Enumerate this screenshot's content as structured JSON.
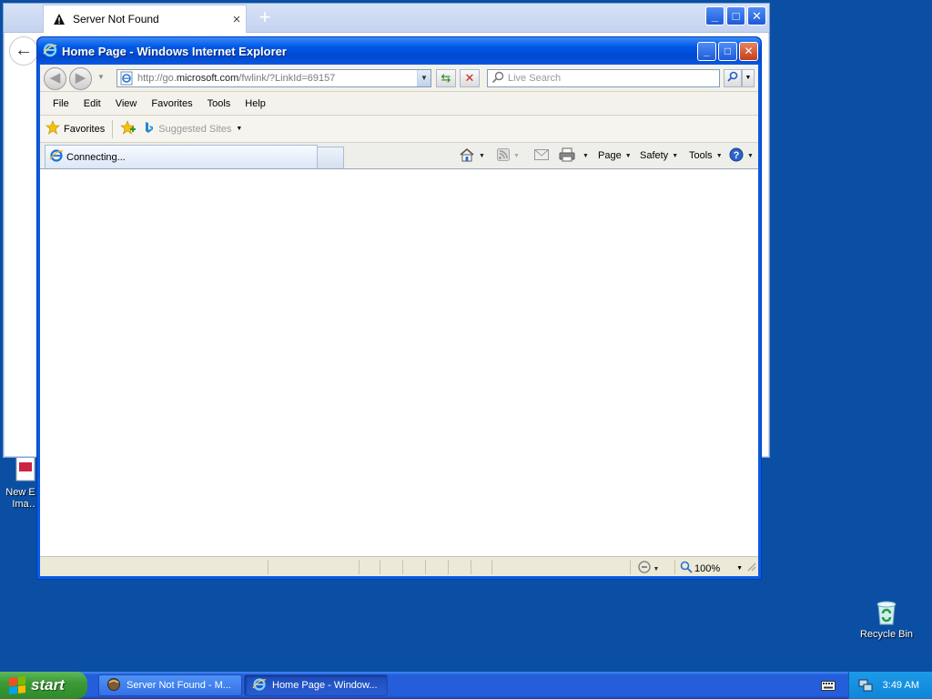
{
  "desktop": {
    "icons": [
      {
        "label": "New E… Ima…"
      },
      {
        "label": "Recycle Bin"
      }
    ]
  },
  "background_window": {
    "tab_title": "Server Not Found",
    "close_tab": "×",
    "new_tab": "+",
    "back_glyph": "←"
  },
  "ie": {
    "title": "Home Page - Windows Internet Explorer",
    "address": {
      "prefix": "http://go.",
      "domain": "microsoft.com",
      "suffix": "/fwlink/?LinkId=69157"
    },
    "search_placeholder": "Live Search",
    "menu": [
      "File",
      "Edit",
      "View",
      "Favorites",
      "Tools",
      "Help"
    ],
    "favorites_label": "Favorites",
    "suggested_sites": "Suggested Sites",
    "tab_label": "Connecting...",
    "commands": {
      "page": "Page",
      "safety": "Safety",
      "tools": "Tools"
    },
    "zoom": "100%"
  },
  "taskbar": {
    "start": "start",
    "tasks": [
      {
        "label": "Server Not Found - M..."
      },
      {
        "label": "Home Page - Window..."
      }
    ],
    "clock": "3:49 AM"
  },
  "colors": {
    "desktop": "#0a4fa3",
    "titlebar": "#0058e6",
    "taskbar": "#245edb",
    "start": "#3c9a36"
  }
}
